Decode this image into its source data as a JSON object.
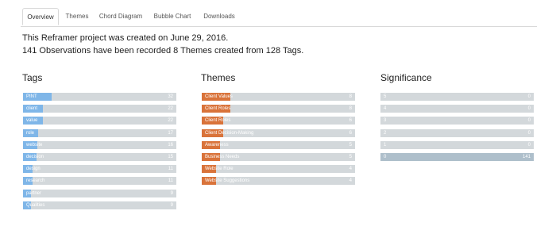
{
  "tabs": [
    "Overview",
    "Themes",
    "Chord Diagram",
    "Bubble Chart",
    "Downloads"
  ],
  "active_tab": "Overview",
  "summary": {
    "line1": "This Reframer project was created on June 29, 2016.",
    "line2": "141 Observations have been recorded 8 Themes created from 128 Tags."
  },
  "colors": {
    "tags": "#7fb6e8",
    "themes": "#d9733a",
    "significance": "#aebfcb",
    "track": "#d3d8db"
  },
  "sections": {
    "tags": {
      "title": "Tags",
      "max": 32,
      "items": [
        {
          "label": "PINT",
          "value": 32
        },
        {
          "label": "client",
          "value": 22
        },
        {
          "label": "value",
          "value": 22
        },
        {
          "label": "role",
          "value": 17
        },
        {
          "label": "website",
          "value": 16
        },
        {
          "label": "decision",
          "value": 15
        },
        {
          "label": "design",
          "value": 11
        },
        {
          "label": "research",
          "value": 11
        },
        {
          "label": "partner",
          "value": 9
        },
        {
          "label": "Qualities",
          "value": 9
        }
      ]
    },
    "themes": {
      "title": "Themes",
      "max": 8,
      "items": [
        {
          "label": "Client Values",
          "value": 8
        },
        {
          "label": "Client Roles",
          "value": 8
        },
        {
          "label": "Client Roles",
          "value": 6
        },
        {
          "label": "Client Decision-Making",
          "value": 6
        },
        {
          "label": "Awareness",
          "value": 5
        },
        {
          "label": "Business Needs",
          "value": 5
        },
        {
          "label": "Website Role",
          "value": 4
        },
        {
          "label": "Website Suggestions",
          "value": 4
        }
      ]
    },
    "significance": {
      "title": "Significance",
      "max": 141,
      "items": [
        {
          "label": "5",
          "value": 0
        },
        {
          "label": "4",
          "value": 0
        },
        {
          "label": "3",
          "value": 0
        },
        {
          "label": "2",
          "value": 0
        },
        {
          "label": "1",
          "value": 0
        },
        {
          "label": "0",
          "value": 141
        }
      ]
    }
  }
}
